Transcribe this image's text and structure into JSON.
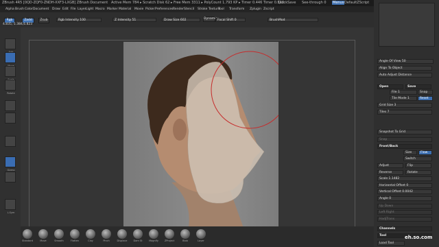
{
  "titlebar": {
    "left": "ZBrush 4R5 [0QD-ZQF0-ZNDH-XXF3-LXGB]  ZBrush Document",
    "stats": "Active Mem 784 ▸ Scratch Disk 62 ▸ Free Mem 3311 ▸ PolyCount 1,793 KP ▸ Timer 0.446 Timer 0.593",
    "quicksave": "QuickSave",
    "seethrough": "See-through 0",
    "menus": "Menus",
    "script": "DefaultZScript"
  },
  "menus": [
    "Alpha",
    "Brush",
    "Color",
    "Document",
    "Draw",
    "Edit",
    "File",
    "Layer",
    "Light",
    "Macro",
    "Marker",
    "Material",
    "Movie",
    "Picker",
    "Preferences",
    "Render",
    "Stencil",
    "Stroke",
    "Texture",
    "Tool",
    "Transform",
    "Zplugin",
    "Zscript"
  ],
  "topbar": {
    "rgb": "Rgb",
    "zadd": "Zadd",
    "zsub": "Zsub",
    "rgb_intensity": "Rgb Intensity 100",
    "z_intensity": "Z Intensity 51",
    "draw_size": "Draw Size 602",
    "dynamic": "Dynamic",
    "focal_shift": "Focal Shift 0",
    "mrgb": "Mrgb",
    "coords": "4.835,-1.384,6.823",
    "brushmod": "BrushMod"
  },
  "lefttray": [
    {
      "label": "Edit",
      "blue": false
    },
    {
      "label": "Move",
      "blue": true
    },
    {
      "label": "Scale",
      "blue": false
    },
    {
      "label": "Rotate",
      "blue": false
    },
    {
      "label": "",
      "blue": false
    },
    {
      "label": "",
      "blue": false
    },
    {
      "label": "",
      "blue": false
    },
    {
      "label": "Gizmo",
      "blue": true
    },
    {
      "label": "",
      "blue": false
    },
    {
      "label": "L.Sym",
      "blue": false
    }
  ],
  "brushes": [
    "Standard",
    "Move",
    "Smooth",
    "Flatten",
    "Clay",
    "Pinch",
    "Displace",
    "Dam St",
    "Magnify",
    "ZProject",
    "Blob",
    "Layer"
  ],
  "rightpanel": {
    "angle_of_view": "Angle Of View 50",
    "align_to_object": "Align To Object",
    "auto_adjust": "Auto Adjust Distance",
    "open": "Open",
    "save": "Save",
    "file": "File 1",
    "tilemode": "Tile Mode 1",
    "snap": "Snap",
    "grid_size": "Grid Size 3",
    "tiles": "Tiles 7",
    "reset": "Reset",
    "snapshot": "Snapshot To Grid",
    "snap2": "Snap",
    "frontback": "Front/Back",
    "size": "Size",
    "flow": "Flow",
    "switch": "Switch",
    "adjust": "Adjust",
    "flip": "Flip",
    "reverse": "Reverse",
    "rotate": "Rotate",
    "scale": "Scale 1.1482",
    "horiz_offset": "Horizontal Offset 0",
    "vert_offset": "Vertical Offset 0.0042",
    "angle": "Angle 0",
    "updown": "Up Down",
    "leftright": "Left Right",
    "hadjust": "HadjTrans",
    "channels": "Channels",
    "tool": "Tool",
    "loadtool": "Load Tool"
  },
  "watermark": "eh.so.com"
}
